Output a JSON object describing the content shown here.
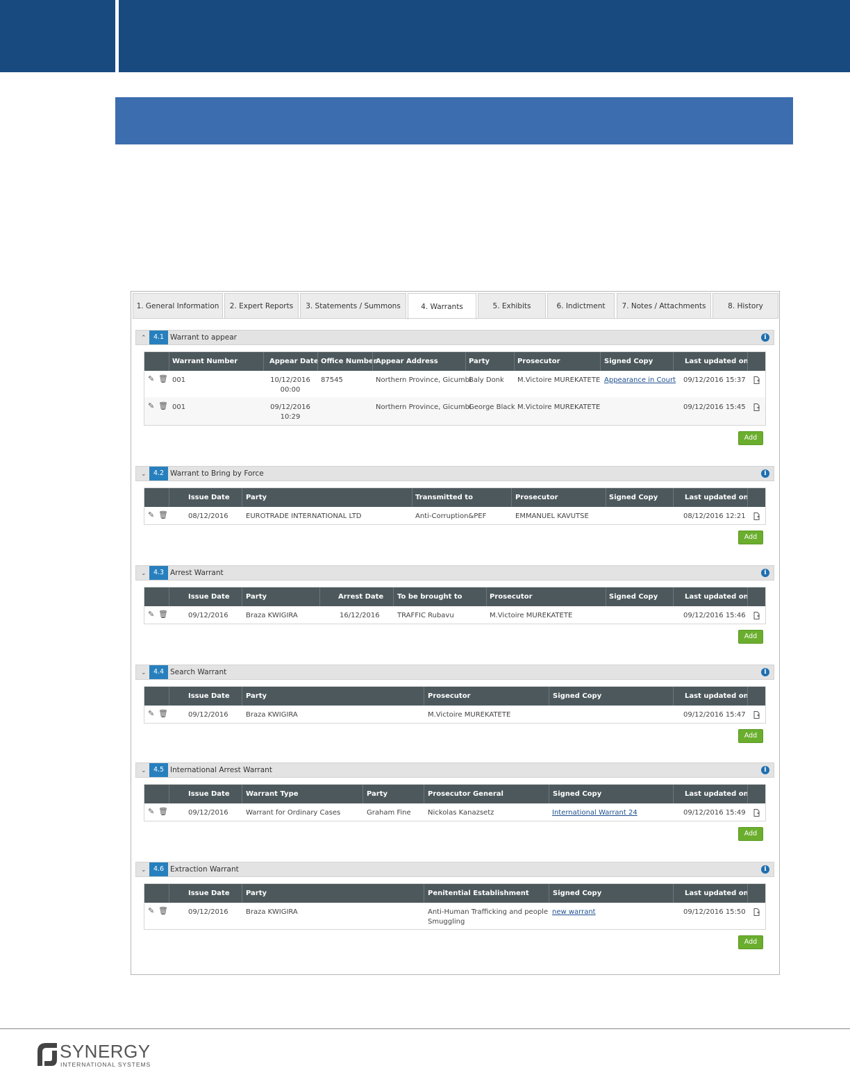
{
  "tabs": [
    {
      "label": "1. General Information"
    },
    {
      "label": "2. Expert Reports"
    },
    {
      "label": "3. Statements / Summons"
    },
    {
      "label": "4. Warrants"
    },
    {
      "label": "5. Exhibits"
    },
    {
      "label": "6. Indictment"
    },
    {
      "label": "7. Notes / Attachments"
    },
    {
      "label": "8. History"
    }
  ],
  "active_tab": "4. Warrants",
  "add_label": "Add",
  "sections": [
    {
      "num": "4.1",
      "title": "Warrant to appear",
      "expanded": true,
      "columns": [
        "Warrant Number",
        "Appear Date",
        "Office Number",
        "Appear Address",
        "Party",
        "Prosecutor",
        "Signed Copy",
        "Last updated on"
      ],
      "rows": [
        {
          "warrant_number": "001",
          "appear_date_1": "10/12/2016",
          "appear_date_2": "00:00",
          "office_number": "87545",
          "appear_address": "Northern Province, Gicumbi",
          "party": "Baly Donk",
          "prosecutor": "M.Victoire MUREKATETE",
          "signed_copy": "Appearance in Court",
          "last_updated": "09/12/2016 15:37"
        },
        {
          "warrant_number": "001",
          "appear_date_1": "09/12/2016",
          "appear_date_2": "10:29",
          "office_number": "",
          "appear_address": "Northern Province, Gicumbi",
          "party": "George Black",
          "prosecutor": "M.Victoire MUREKATETE",
          "signed_copy": "",
          "last_updated": "09/12/2016 15:45"
        }
      ]
    },
    {
      "num": "4.2",
      "title": "Warrant to Bring by Force",
      "expanded": false,
      "columns": [
        "Issue Date",
        "Party",
        "Transmitted to",
        "Prosecutor",
        "Signed Copy",
        "Last updated on"
      ],
      "rows": [
        {
          "issue_date": "08/12/2016",
          "party": "EUROTRADE INTERNATIONAL LTD",
          "transmitted_to": "Anti-Corruption&PEF",
          "prosecutor": "EMMANUEL KAVUTSE",
          "signed_copy": "",
          "last_updated": "08/12/2016 12:21"
        }
      ]
    },
    {
      "num": "4.3",
      "title": "Arrest Warrant",
      "expanded": false,
      "columns": [
        "Issue Date",
        "Party",
        "Arrest Date",
        "To be brought to",
        "Prosecutor",
        "Signed Copy",
        "Last updated on"
      ],
      "rows": [
        {
          "issue_date": "09/12/2016",
          "party": "Braza KWIGIRA",
          "arrest_date": "16/12/2016",
          "brought_to": "TRAFFIC Rubavu",
          "prosecutor": "M.Victoire MUREKATETE",
          "signed_copy": "",
          "last_updated": "09/12/2016 15:46"
        }
      ]
    },
    {
      "num": "4.4",
      "title": "Search Warrant",
      "expanded": false,
      "columns": [
        "Issue Date",
        "Party",
        "Prosecutor",
        "Signed Copy",
        "Last updated on"
      ],
      "rows": [
        {
          "issue_date": "09/12/2016",
          "party": "Braza KWIGIRA",
          "prosecutor": "M.Victoire MUREKATETE",
          "signed_copy": "",
          "last_updated": "09/12/2016 15:47"
        }
      ]
    },
    {
      "num": "4.5",
      "title": "International Arrest Warrant",
      "expanded": false,
      "columns": [
        "Issue Date",
        "Warrant Type",
        "Party",
        "Prosecutor General",
        "Signed Copy",
        "Last updated on"
      ],
      "rows": [
        {
          "issue_date": "09/12/2016",
          "warrant_type": "Warrant for Ordinary Cases",
          "party": "Graham Fine",
          "prosecutor_general": "Nickolas Kanazsetz",
          "signed_copy": "International Warrant 24",
          "last_updated": "09/12/2016 15:49"
        }
      ]
    },
    {
      "num": "4.6",
      "title": "Extraction Warrant",
      "expanded": false,
      "columns": [
        "Issue Date",
        "Party",
        "Penitential Establishment",
        "Signed Copy",
        "Last updated on"
      ],
      "rows": [
        {
          "issue_date": "09/12/2016",
          "party": "Braza KWIGIRA",
          "establishment_1": "Anti-Human Trafficking and people",
          "establishment_2": "Smuggling",
          "signed_copy": "new warrant",
          "last_updated": "09/12/2016 15:50"
        }
      ]
    }
  ],
  "footer": {
    "logo_name": "SYNERGY",
    "logo_sub": "INTERNATIONAL SYSTEMS"
  }
}
